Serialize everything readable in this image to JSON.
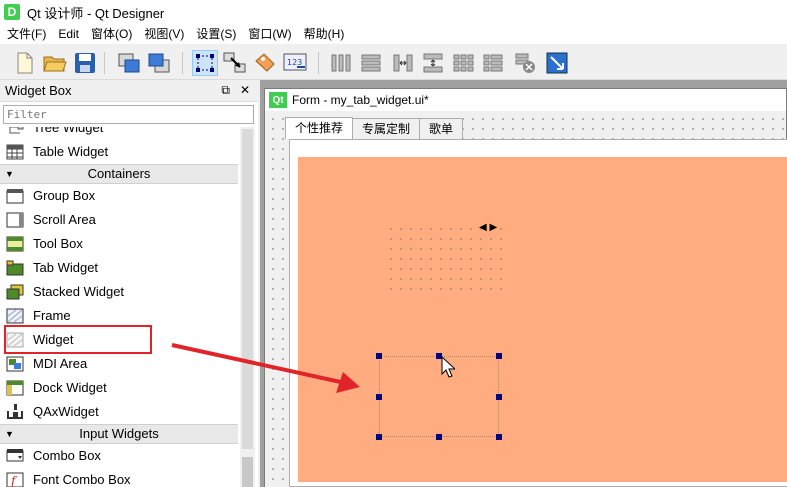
{
  "window": {
    "title": "Qt 设计师 - Qt Designer",
    "icon_letter": "D"
  },
  "menu": [
    "文件(F)",
    "Edit",
    "窗体(O)",
    "视图(V)",
    "设置(S)",
    "窗口(W)",
    "帮助(H)"
  ],
  "widget_box": {
    "title": "Widget Box",
    "float_glyph": "⧉",
    "close_glyph": "✕",
    "filter_placeholder": "Filter",
    "items": [
      {
        "label": "Tree Widget",
        "icon": "tree-widget-icon"
      },
      {
        "label": "Table Widget",
        "icon": "table-widget-icon"
      },
      {
        "category": "Containers"
      },
      {
        "label": "Group Box",
        "icon": "group-box-icon"
      },
      {
        "label": "Scroll Area",
        "icon": "scroll-area-icon"
      },
      {
        "label": "Tool Box",
        "icon": "tool-box-icon"
      },
      {
        "label": "Tab Widget",
        "icon": "tab-widget-icon"
      },
      {
        "label": "Stacked Widget",
        "icon": "stacked-widget-icon"
      },
      {
        "label": "Frame",
        "icon": "frame-icon"
      },
      {
        "label": "Widget",
        "icon": "widget-icon"
      },
      {
        "label": "MDI Area",
        "icon": "mdi-area-icon"
      },
      {
        "label": "Dock Widget",
        "icon": "dock-widget-icon"
      },
      {
        "label": "QAxWidget",
        "icon": "qaxwidget-icon"
      },
      {
        "category": "Input Widgets"
      },
      {
        "label": "Combo Box",
        "icon": "combo-box-icon"
      },
      {
        "label": "Font Combo Box",
        "icon": "font-combo-box-icon"
      }
    ]
  },
  "form": {
    "title": "Form - my_tab_widget.ui*",
    "logo": "Qt",
    "tabs": [
      "个性推荐",
      "专属定制",
      "歌单"
    ],
    "active_tab": 0
  },
  "colors": {
    "tab_page_fill": "#ffac80",
    "highlight_box": "#e0242a",
    "selection_handle": "#000080"
  }
}
